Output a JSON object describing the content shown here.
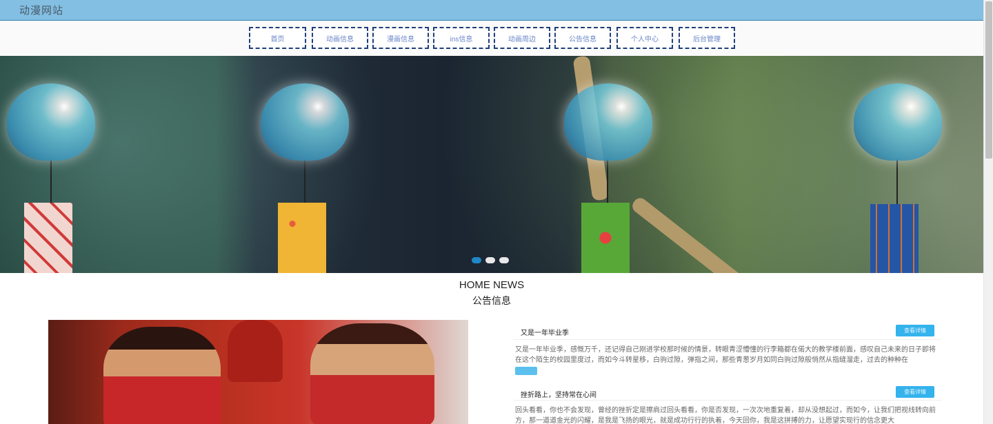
{
  "header": {
    "site_title": "动漫网站"
  },
  "nav": {
    "items": [
      {
        "label": "首页"
      },
      {
        "label": "动画信息"
      },
      {
        "label": "漫画信息"
      },
      {
        "label": "ins信息"
      },
      {
        "label": "动画周边"
      },
      {
        "label": "公告信息"
      },
      {
        "label": "个人中心"
      },
      {
        "label": "后台管理"
      }
    ]
  },
  "banner": {
    "slide_count": 3,
    "active_slide": 1
  },
  "news": {
    "title_en": "HOME NEWS",
    "title_cn": "公告信息",
    "articles": [
      {
        "title": "又是一年毕业季",
        "text": "又是一年毕业季，感慨万千，还记得自己刚进学校那时候的情景，转眼青涩懵懂的行李箱都在偌大的教学楼前面，感叹自己未来的日子即将在这个陌生的校园里度过，而如今斗转星移，白驹过隙，弹指之间，那些青葱岁月如同白驹过隙般悄然从指缝溜走，过去的种种在",
        "more": "查看详情"
      },
      {
        "title": "挫折路上，坚持常在心间",
        "text": "回头看看，你也不会发现，曾经的挫折定是擦肩过回头看看，你是否发现，一次次地重复着，却从没想起过，而如今，让我们把视线转向前方，那一道道金光的闪耀，是我是飞扬的眼光，就是成功行行的执着，今天回你，我是这拼搏的力，让愿望实现行的信念更大",
        "more": "查看详情"
      }
    ]
  }
}
